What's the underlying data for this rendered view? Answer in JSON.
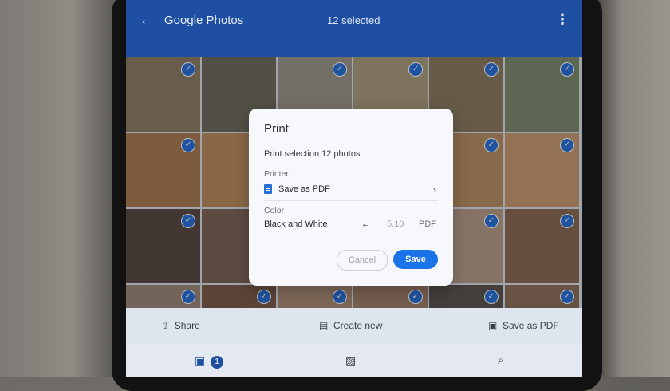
{
  "header": {
    "app_title": "Google Photos",
    "selected_text": "12 selected"
  },
  "dialog": {
    "title": "Print",
    "subtitle": "Print selection 12 photos",
    "printer_label": "Printer",
    "printer_value": "Save as PDF",
    "color_label": "Color",
    "color_value": "Black and White",
    "page_range": "5.10",
    "pdf_label": "PDF",
    "cancel_label": "Cancel",
    "save_label": "Save"
  },
  "actions": {
    "share_label": "Share",
    "create_label": "Create new",
    "save_pdf_label": "Save as PDF"
  },
  "bottom_nav": {
    "photos_badge": "1"
  },
  "colors": {
    "header_blue": "#1e4fa3",
    "accent_blue": "#1a73e8",
    "check_blue": "#2a6fd6"
  },
  "photos": [
    {
      "name": "man-dogs-yard",
      "fill": "#8b7b63",
      "checked": true
    },
    {
      "name": "dogs-lying",
      "fill": "#6d6a5e",
      "checked": false
    },
    {
      "name": "dogs-group",
      "fill": "#9a9488",
      "checked": true
    },
    {
      "name": "dogs-yard",
      "fill": "#a89a7c",
      "checked": true
    },
    {
      "name": "woman-dog",
      "fill": "#8a7a60",
      "checked": true
    },
    {
      "name": "man-dog-bench",
      "fill": "#7e8a70",
      "checked": true
    },
    {
      "name": "dog-floor",
      "fill": "#a77a52",
      "checked": true
    },
    {
      "name": "dog-floor-2",
      "fill": "#b88a5e",
      "checked": false
    },
    {
      "name": "hidden-1",
      "fill": "#a89880",
      "checked": false
    },
    {
      "name": "hidden-2",
      "fill": "#a89880",
      "checked": false
    },
    {
      "name": "dog-wall",
      "fill": "#b68d63",
      "checked": true
    },
    {
      "name": "dog-kitchen",
      "fill": "#c49a70",
      "checked": true
    },
    {
      "name": "kids-couch",
      "fill": "#5a4a46",
      "checked": true
    },
    {
      "name": "kids-2",
      "fill": "#7c6458",
      "checked": false
    },
    {
      "name": "hidden-3",
      "fill": "#6c5a50",
      "checked": false
    },
    {
      "name": "hidden-4",
      "fill": "#6c5a50",
      "checked": false
    },
    {
      "name": "baby",
      "fill": "#b49a88",
      "checked": true
    },
    {
      "name": "boy-smile",
      "fill": "#8a6a54",
      "checked": true
    },
    {
      "name": "kid-1",
      "fill": "#9a8678",
      "checked": true
    },
    {
      "name": "kid-2",
      "fill": "#7a5a4a",
      "checked": true
    },
    {
      "name": "kid-3",
      "fill": "#a88a74",
      "checked": true
    },
    {
      "name": "kid-4",
      "fill": "#9e7e68",
      "checked": true
    },
    {
      "name": "dog-close",
      "fill": "#5a5450",
      "checked": true
    },
    {
      "name": "kid-5",
      "fill": "#8a6e5a",
      "checked": true
    }
  ]
}
